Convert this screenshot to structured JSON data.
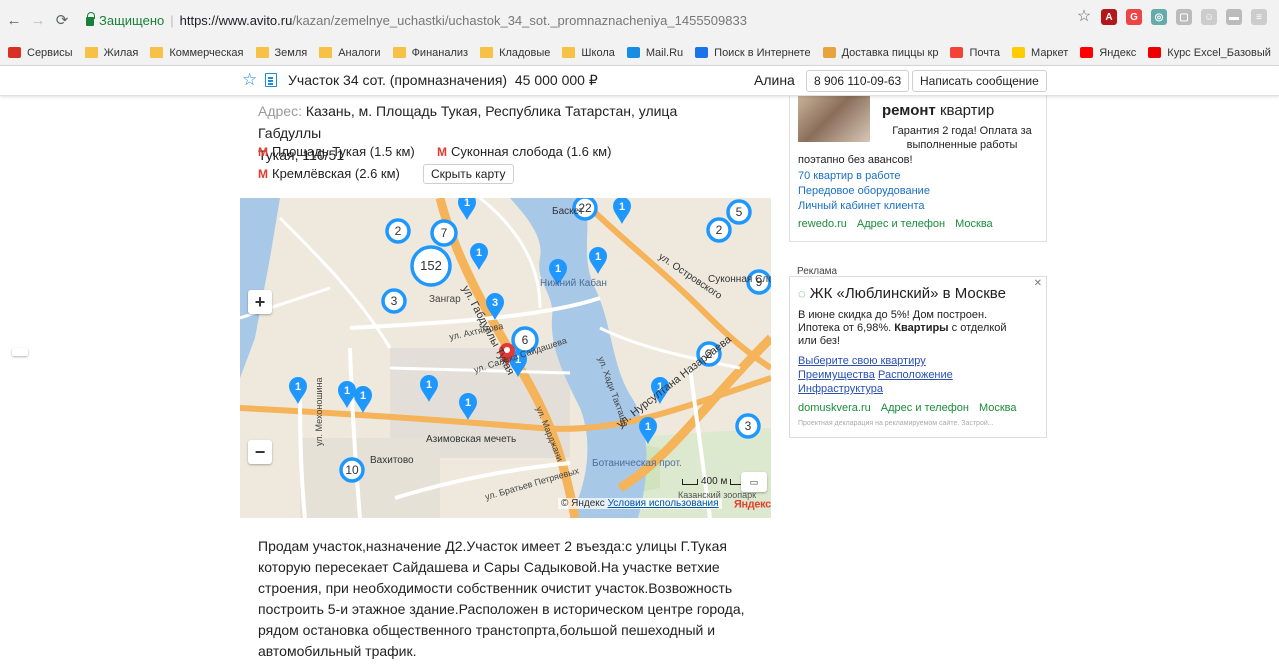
{
  "browser": {
    "secure_label": "Защищено",
    "url_host": "https://www.avito.ru",
    "url_path": "/kazan/zemelnye_uchastki/uchastok_34_sot._promnaznacheniya_1455509833"
  },
  "bookmarks": [
    {
      "label": "Сервисы",
      "icon": "apps-icon",
      "color": "#d93025"
    },
    {
      "label": "Жилая",
      "icon": "folder-icon",
      "color": "#f6c144"
    },
    {
      "label": "Коммерческая",
      "icon": "folder-icon",
      "color": "#f6c144"
    },
    {
      "label": "Земля",
      "icon": "folder-icon",
      "color": "#f6c144"
    },
    {
      "label": "Аналоги",
      "icon": "folder-icon",
      "color": "#f6c144"
    },
    {
      "label": "Финанализ",
      "icon": "folder-icon",
      "color": "#f6c144"
    },
    {
      "label": "Кладовые",
      "icon": "folder-icon",
      "color": "#f6c144"
    },
    {
      "label": "Школа",
      "icon": "folder-icon",
      "color": "#f6c144"
    },
    {
      "label": "Mail.Ru",
      "icon": "mailru-icon",
      "color": "#168de2"
    },
    {
      "label": "Поиск в Интернете",
      "icon": "search-icon",
      "color": "#1a73e8"
    },
    {
      "label": "Доставка пиццы кр",
      "icon": "pizza-icon",
      "color": "#e8a33c"
    },
    {
      "label": "Почта",
      "icon": "mail-icon",
      "color": "#f44336"
    },
    {
      "label": "Маркет",
      "icon": "market-icon",
      "color": "#ffcc00"
    },
    {
      "label": "Яндекс",
      "icon": "yandex-icon",
      "color": "#f00"
    },
    {
      "label": "Курс Excel_Базовый",
      "icon": "youtube-icon",
      "color": "#e00"
    }
  ],
  "header": {
    "title": "Участок 34 сот. (промназначения)",
    "price": "45 000 000 ₽",
    "seller": "Алина",
    "phone": "8 906 110-09-63",
    "message_button": "Написать сообщение"
  },
  "listing": {
    "address_label": "Адрес:",
    "address_line1": "Казань, м. Площадь Тукая, Республика Татарстан, улица Габдуллы",
    "address_line2": "Тукая, 110/51",
    "metro": [
      {
        "name": "Площадь Тукая",
        "distance": "(1.5 км)"
      },
      {
        "name": "Суконная слобода",
        "distance": "(1.6 км)"
      },
      {
        "name": "Кремлёвская",
        "distance": "(2.6 км)"
      }
    ],
    "hide_map_button": "Скрыть карту",
    "description": [
      "Продам участок,назначение Д2.Участок имеет 2 въезда:с улицы Г.Тукая",
      "которую пересекает Сайдашева и Сары Садыковой.На участке ветхие",
      "строения, при необходимости собственник очистит участок.Возвожность",
      "построить 5-и этажное здание.Расположен в историческом центре города,",
      "рядом остановка общественного транстопрта,большой пешеходный и",
      "автомобильный трафик."
    ]
  },
  "map": {
    "cluster_counts": [
      "2",
      "7",
      "152",
      "3",
      "6",
      "22",
      "5",
      "2",
      "9",
      "2",
      "3",
      "10"
    ],
    "pin_counts": [
      "1",
      "1",
      "1",
      "3",
      "1",
      "1",
      "1",
      "1",
      "1",
      "1",
      "1",
      "1",
      "1",
      "1"
    ],
    "labels": {
      "zangar": "Зангар",
      "nizhny_kaban": "Нижний Кабан",
      "sukonnaya": "Суконная Слобода",
      "vakhitovo": "Вахитово",
      "azimov": "Азимовская мечеть",
      "botanic": "Ботаническая прот.",
      "ul_tukaya": "ул. Габдуллы Тукая",
      "ul_nur": "ул. Нурсултана Назарбаева",
      "ul_ostrovskogo": "ул. Островского",
      "ul_akhtamova": "ул. Ахтямова",
      "ul_sali": "ул. Салиха Сайдашева",
      "ul_petr": "ул. Братьев Петряевых",
      "ul_kh_taktash": "ул. Хади Такташа",
      "ul_marj": "ул. Марджани",
      "ul_mekh": "ул. Мехоношина",
      "zoo": "Казанский зоопарк",
      "basket": "Баскет"
    },
    "scale_label": "400 м",
    "copyright": "© Яндекс",
    "terms_link": "Условия использования",
    "logo": "Яндекс"
  },
  "ads": {
    "ad1": {
      "title_bold": "ремонт",
      "title_rest": "квартир",
      "subtitle": "Гарантия 2 года! Оплата за выполненные работы",
      "subtitle2": "поэтапно без авансов!",
      "links": [
        "70 квартир в работе",
        "Передовое оборудование",
        "Личный кабинет клиента"
      ],
      "domain": "rewedo.ru",
      "contacts": "Адрес и телефон",
      "city": "Москва"
    },
    "label": "Реклама",
    "ad2": {
      "title": "ЖК «Люблинский» в Москве",
      "body_1": "В июне скидка до 5%! Дом построен.",
      "body_2a": "Ипотека от 6,98%.",
      "body_2b": "Квартиры",
      "body_2c": "с отделкой",
      "body_3": "или без!",
      "links": [
        "Выберите свою квартиру",
        "Преимущества",
        "Расположение",
        "Инфраструктура"
      ],
      "domain": "domuskvera.ru",
      "contacts": "Адрес и телефон",
      "city": "Москва",
      "note": "Проектная декларация на рекламируемом сайте. Застрой..."
    }
  }
}
